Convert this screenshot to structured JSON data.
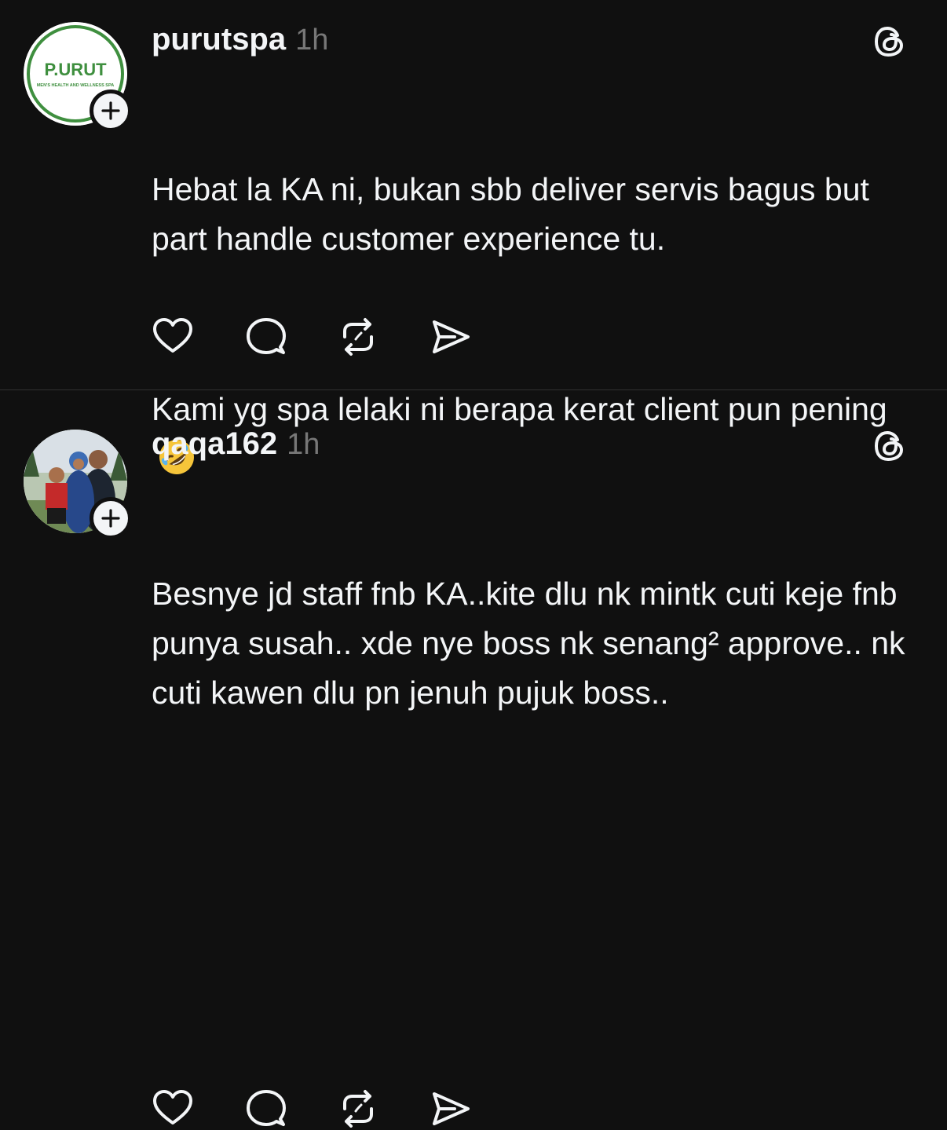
{
  "colors": {
    "background": "#101010",
    "text_primary": "#f3f5f7",
    "text_secondary": "#777777",
    "divider": "#323232",
    "logo_green": "#3f8f3f"
  },
  "posts": [
    {
      "username": "purutspa",
      "timestamp": "1h",
      "avatar": {
        "logo_text": "P.URUT",
        "logo_subtext": "MEN'S HEALTH AND WELLNESS SPA"
      },
      "paragraphs": [
        "Hebat la KA ni, bukan sbb deliver servis bagus but part handle customer experience tu.",
        "Kami yg spa lelaki ni berapa kerat client pun pening"
      ],
      "emoji": "rolling-on-floor-laughing-emoji",
      "icons": [
        "heart-icon",
        "comment-icon",
        "repost-icon",
        "share-icon",
        "threads-logo-icon",
        "follow-plus-icon"
      ]
    },
    {
      "username": "qaqa162",
      "timestamp": "1h",
      "avatar": {
        "type": "family-photo"
      },
      "paragraphs": [
        "Besnye jd staff fnb KA..kite dlu nk mintk cuti keje fnb punya susah.. xde nye boss nk senang² approve.. nk cuti kawen dlu pn jenuh pujuk boss.."
      ],
      "icons": [
        "heart-icon",
        "comment-icon",
        "repost-icon",
        "share-icon",
        "threads-logo-icon",
        "follow-plus-icon"
      ]
    }
  ]
}
